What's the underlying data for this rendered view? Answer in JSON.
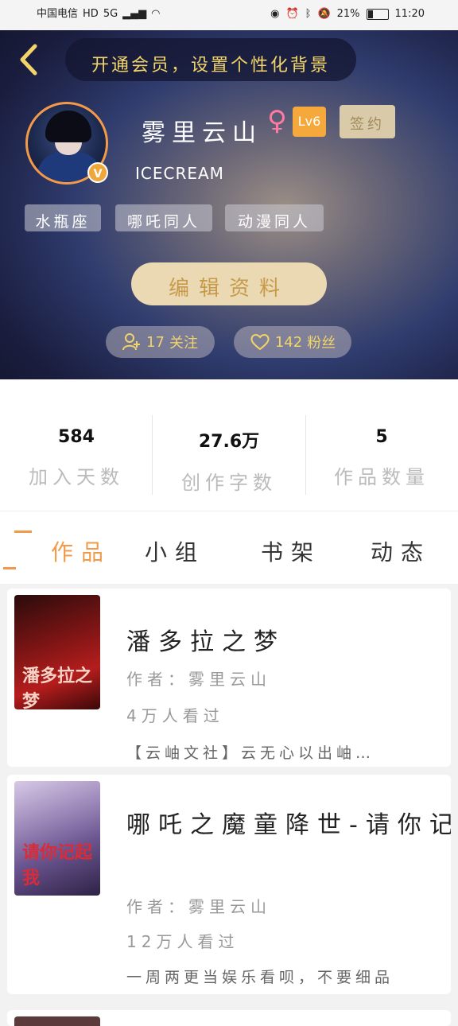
{
  "status_bar": {
    "carrier": "中国电信",
    "network": "5G",
    "battery": "21%",
    "time": "11:20"
  },
  "header": {
    "vip_banner": "开通会员，设置个性化背景",
    "username": "雾里云山",
    "gender_symbol": "♀",
    "level": "Lv6",
    "sign_button": "签约",
    "nickname": "ICECREAM",
    "avatar_badge": "V",
    "tags": [
      "水瓶座",
      "哪吒同人",
      "动漫同人"
    ],
    "edit_button": "编辑资料",
    "following": {
      "count": "17",
      "label": "关注"
    },
    "followers": {
      "count": "142",
      "label": "粉丝"
    }
  },
  "stats": [
    {
      "value": "584",
      "label": "加入天数"
    },
    {
      "value": "27.6万",
      "label": "创作字数"
    },
    {
      "value": "5",
      "label": "作品数量"
    }
  ],
  "tabs": [
    {
      "label": "作品",
      "active": true
    },
    {
      "label": "小组",
      "active": false
    },
    {
      "label": "书架",
      "active": false
    },
    {
      "label": "动态",
      "active": false
    }
  ],
  "works": [
    {
      "title": "潘多拉之梦",
      "author": "作者：雾里云山",
      "readers": "4万人看过",
      "description": "【云岫文社】云无心以出岫…",
      "cover_text": "潘多拉之梦"
    },
    {
      "title": "哪吒之魔童降世-请你记",
      "author": "作者：雾里云山",
      "readers": "12万人看过",
      "description": "一周两更当娱乐看呗，不要细品",
      "cover_text": "请你记起我"
    }
  ],
  "colors": {
    "accent": "#f39a4a",
    "gold": "#f2d46a",
    "level_badge": "#f5a93c"
  }
}
